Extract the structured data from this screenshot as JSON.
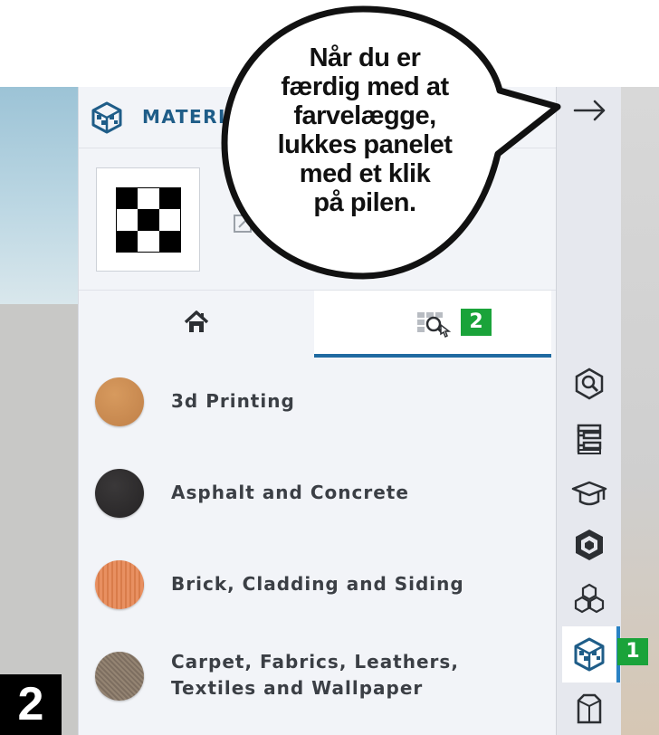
{
  "panel": {
    "title": "MATERI",
    "tabs": [
      {
        "name": "home"
      },
      {
        "name": "browse",
        "badge": "2"
      }
    ],
    "materials": [
      {
        "label": "3d Printing",
        "swatch_color": "#c98a4f"
      },
      {
        "label": "Asphalt and Concrete",
        "swatch_color": "#2f2d2e"
      },
      {
        "label": "Brick, Cladding and Siding",
        "swatch_color": "#e88a58"
      },
      {
        "label_line1": "Carpet, Fabrics, Leathers,",
        "label_line2": "Textiles and Wallpaper",
        "swatch_color": "#8e7e6e"
      }
    ]
  },
  "callout": {
    "lines": [
      "Når du er",
      "færdig med at",
      "farvelægge,",
      "lukkes panelet",
      "med et klik",
      "på pilen."
    ]
  },
  "toolbar": {
    "badge": "1",
    "items": [
      "tags-icon",
      "outliner-icon",
      "instructor-icon",
      "components-icon",
      "stacked-cubes-icon",
      "materials-icon",
      "styles-icon"
    ]
  },
  "step_badge": "2",
  "colors": {
    "accent": "#1f6aa1",
    "badge_green": "#1aa33a",
    "title_blue": "#1f5d88"
  }
}
